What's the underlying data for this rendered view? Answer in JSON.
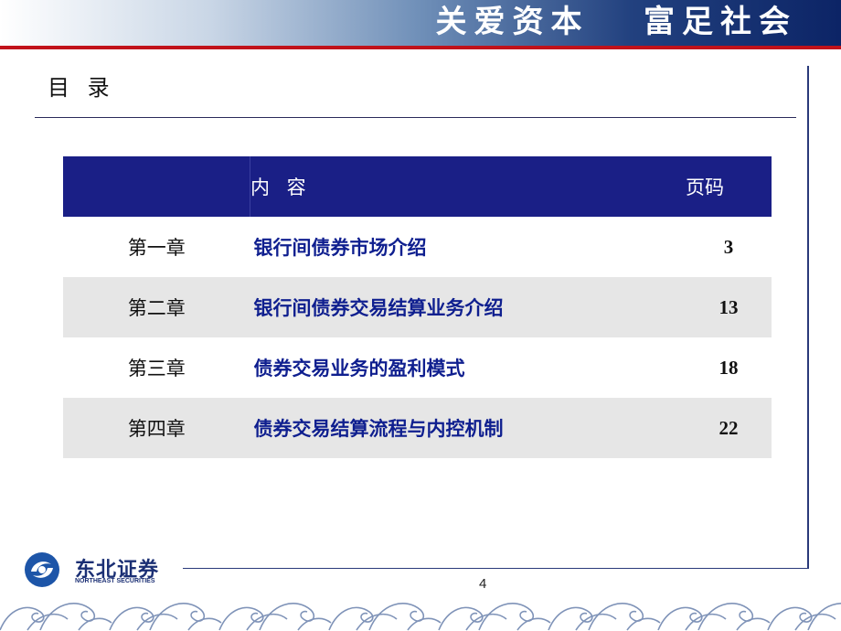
{
  "header": {
    "slogan": "关爱资本   富足社会"
  },
  "page_title": "目 录",
  "toc": {
    "col_content": "内  容",
    "col_page": "页码",
    "rows": [
      {
        "chapter": "第一章",
        "content": "银行间债券市场介绍",
        "page": "3"
      },
      {
        "chapter": "第二章",
        "content": "银行间债券交易结算业务介绍",
        "page": "13"
      },
      {
        "chapter": "第三章",
        "content": "债券交易业务的盈利模式",
        "page": "18"
      },
      {
        "chapter": "第四章",
        "content": "债券交易结算流程与内控机制",
        "page": "22"
      }
    ]
  },
  "footer": {
    "logo_cn": "东北证券",
    "logo_en": "NORTHEAST SECURITIES",
    "page_number": "4"
  },
  "colors": {
    "header_band": "#1a1f86",
    "accent_red": "#c1121a",
    "content_text": "#0f1f8f",
    "alt_row": "#e6e6e6"
  }
}
